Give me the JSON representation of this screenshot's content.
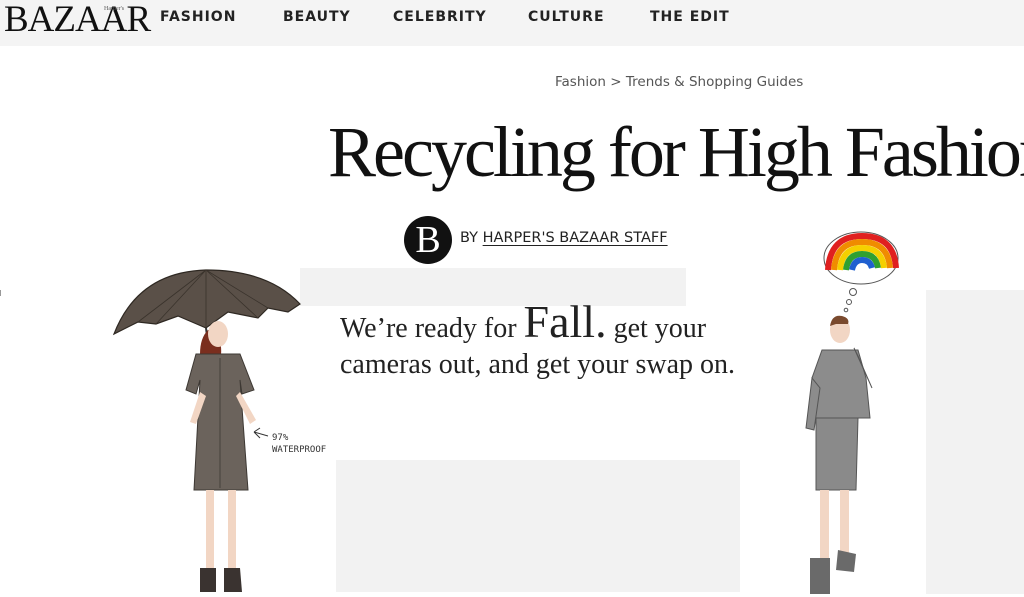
{
  "nav": {
    "logo": "BAZAAR",
    "logo_small": "Harper's",
    "items": [
      "FASHION",
      "BEAUTY",
      "CELEBRITY",
      "CULTURE",
      "THE EDIT"
    ]
  },
  "breadcrumb": {
    "section": "Fashion",
    "separator": ">",
    "subsection": "Trends & Shopping Guides"
  },
  "article": {
    "title": "Recycling for High Fashion",
    "byline_prefix": "BY",
    "author": "HARPER'S BAZAAR STAFF",
    "badge_letter": "B",
    "intro_part1": "We’re ready for",
    "intro_big": "Fall.",
    "intro_part2": "get your cameras out, and get your swap on."
  },
  "illustration": {
    "annotation_line1": "97%",
    "annotation_line2": "WATERPROOF"
  },
  "colors": {
    "nav_bg": "#f4f4f4",
    "text": "#111111",
    "placeholder_gray": "#f2f2f2",
    "umbrella": "#5a5048",
    "dress": "#6b635c",
    "suit": "#8c8c8c"
  }
}
